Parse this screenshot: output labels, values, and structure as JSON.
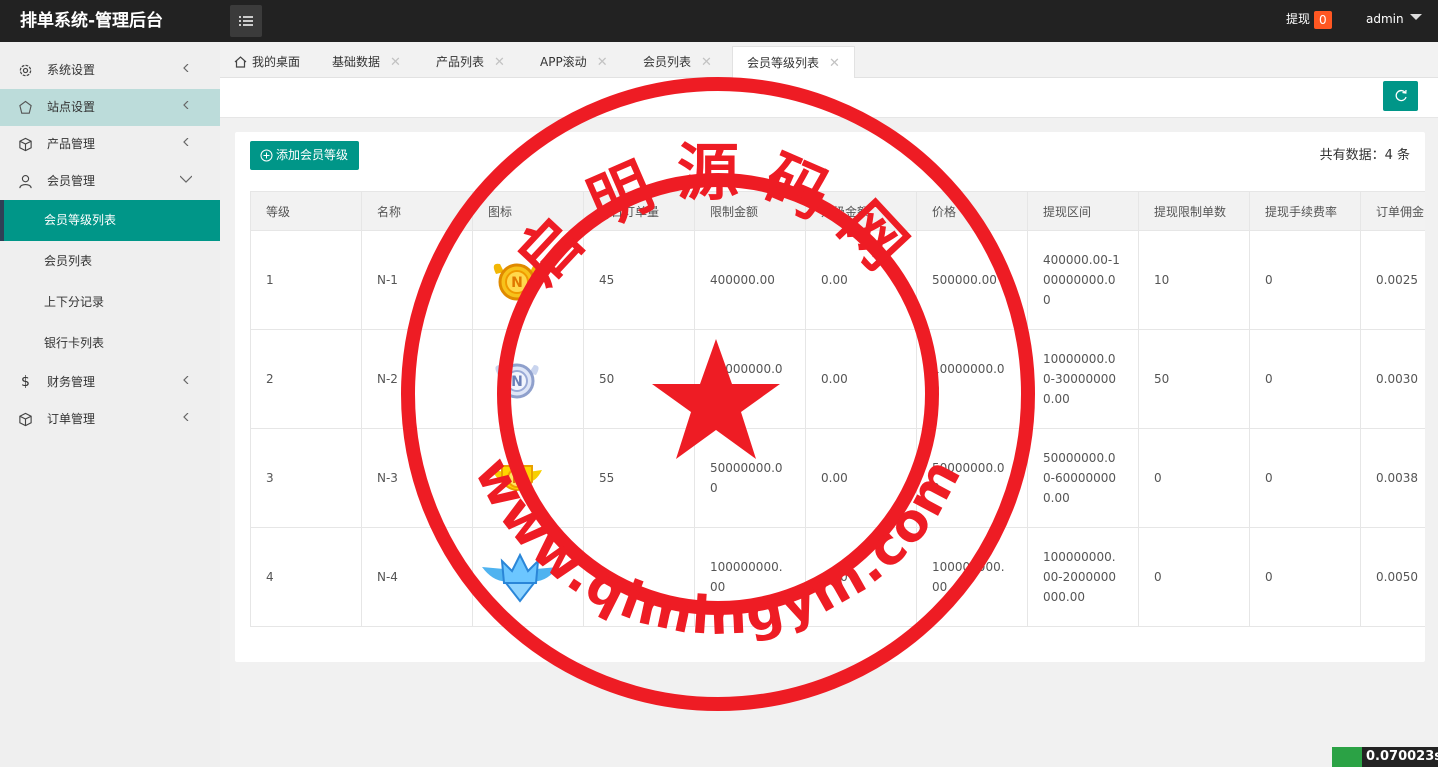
{
  "header": {
    "title": "排单系统-管理后台",
    "withdraw_label": "提现",
    "withdraw_count": "0",
    "user_name": "admin"
  },
  "sidebar": {
    "items": [
      {
        "label": "系统设置"
      },
      {
        "label": "站点设置"
      },
      {
        "label": "产品管理"
      },
      {
        "label": "会员管理"
      },
      {
        "label": "财务管理"
      },
      {
        "label": "订单管理"
      }
    ],
    "member_sub": [
      {
        "label": "会员等级列表"
      },
      {
        "label": "会员列表"
      },
      {
        "label": "上下分记录"
      },
      {
        "label": "银行卡列表"
      }
    ]
  },
  "tabs": [
    {
      "label": "我的桌面"
    },
    {
      "label": "基础数据"
    },
    {
      "label": "产品列表"
    },
    {
      "label": "APP滚动"
    },
    {
      "label": "会员列表"
    },
    {
      "label": "会员等级列表"
    }
  ],
  "toolbar": {
    "add_label": "添加会员等级",
    "total_text": "共有数据：4 条"
  },
  "table": {
    "headers": [
      "等级",
      "名称",
      "图标",
      "每日订单量",
      "限制金额",
      "升级金额",
      "价格",
      "提现区间",
      "提现限制单数",
      "提现手续费率",
      "订单佣金"
    ],
    "rows": [
      [
        "1",
        "N-1",
        "",
        "45",
        "400000.00",
        "0.00",
        "500000.00",
        "400000.00-100000000.00",
        "10",
        "0",
        "0.0025"
      ],
      [
        "2",
        "N-2",
        "",
        "50",
        "10000000.00",
        "0.00",
        "10000000.00",
        "10000000.00-300000000.00",
        "50",
        "0",
        "0.0030"
      ],
      [
        "3",
        "N-3",
        "",
        "55",
        "50000000.00",
        "0.00",
        "50000000.00",
        "50000000.00-600000000.00",
        "0",
        "0",
        "0.0038"
      ],
      [
        "4",
        "N-4",
        "",
        "60",
        "100000000.00",
        "0.00",
        "100000000.00",
        "100000000.00-2000000000.00",
        "0",
        "0",
        "0.0050"
      ]
    ],
    "icon_names": [
      "gold-n-badge-icon",
      "silver-n-badge-icon",
      "gold-wing-badge-icon",
      "diamond-crown-badge-icon"
    ]
  },
  "watermark": {
    "top_text": "启明源码网",
    "bottom_text": "www.qimingym.com"
  },
  "timer": {
    "value": "0.070023s"
  },
  "colors": {
    "primary": "#009688",
    "topbar": "#222222",
    "badge": "#ff5722",
    "stamp": "#ee1c24"
  }
}
